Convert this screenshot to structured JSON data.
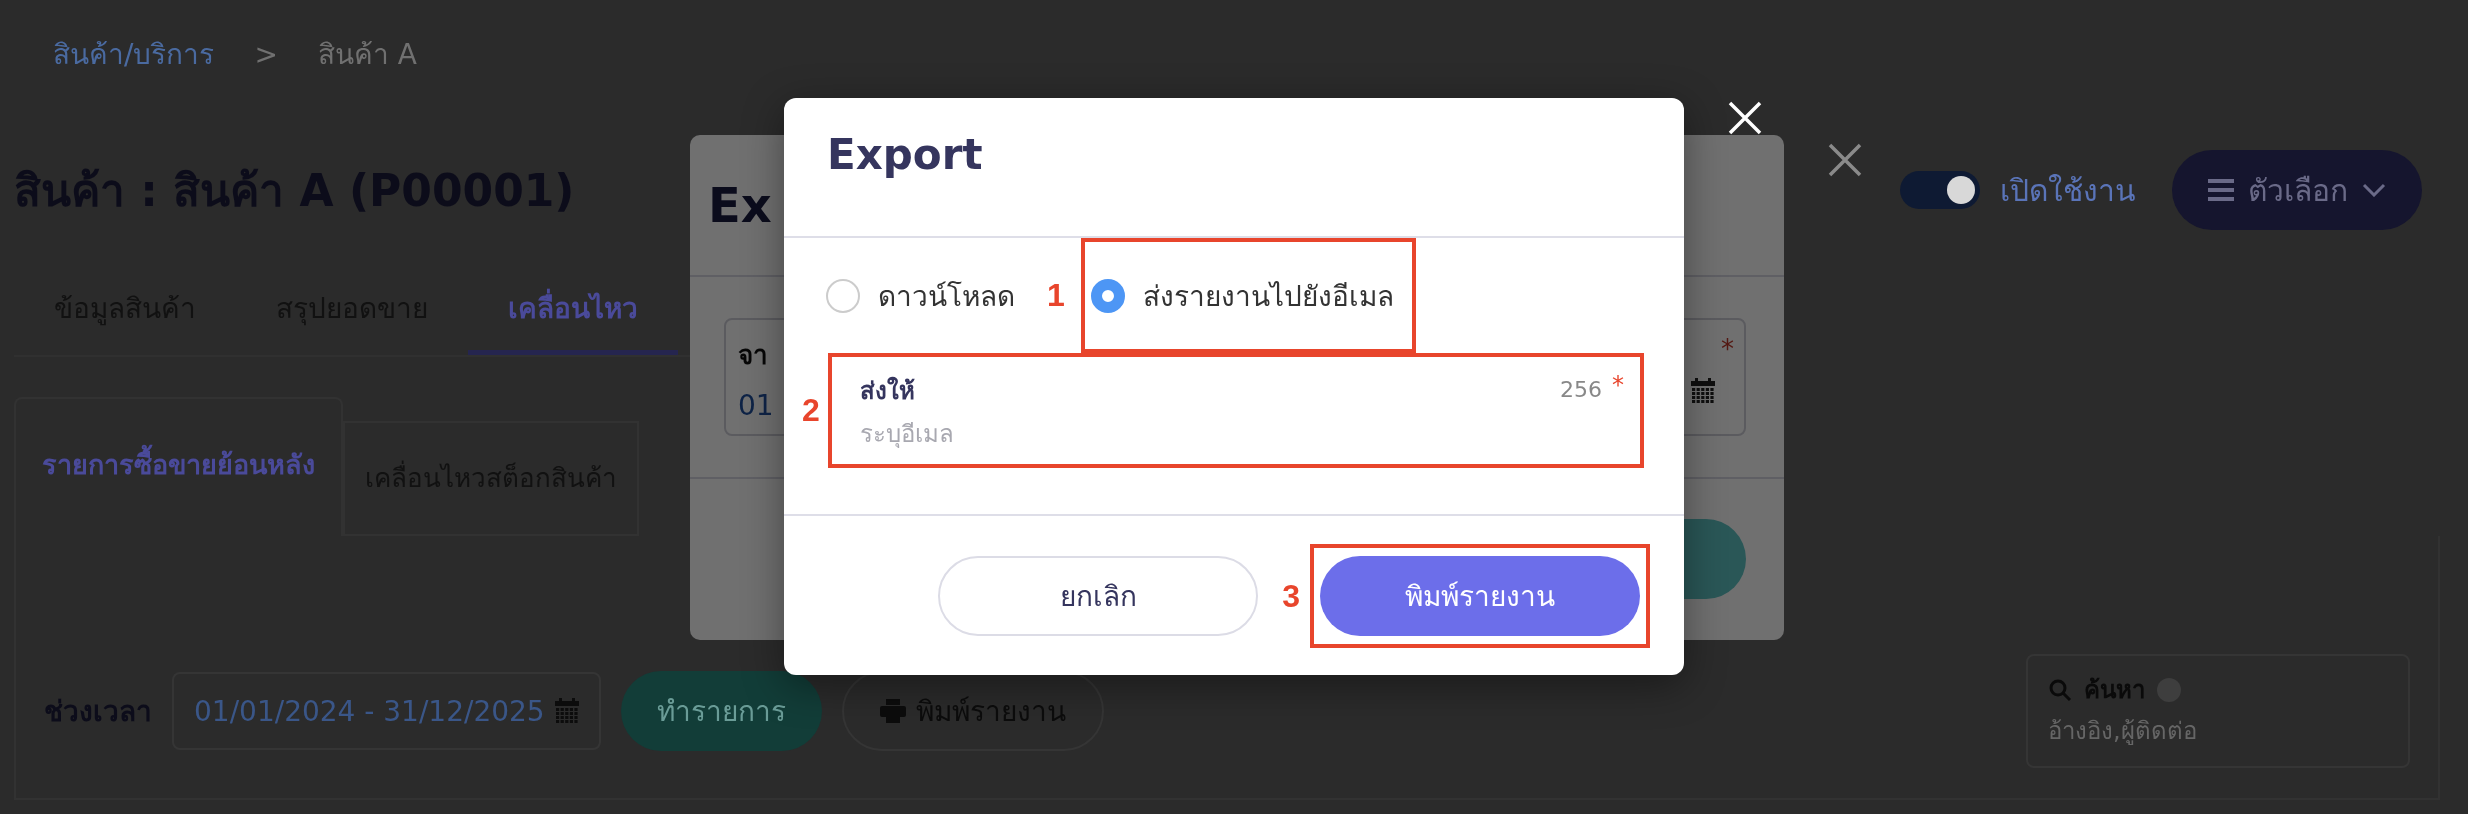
{
  "breadcrumb": [
    {
      "label": "สินค้า/บริการ",
      "kind": "link"
    },
    {
      "label": ">",
      "kind": "separator"
    },
    {
      "label": "สินค้า A",
      "kind": "current"
    }
  ],
  "page_title": "สินค้า : สินค้า A (P00001)",
  "status_toggle": {
    "label": "เปิดใช้งาน",
    "on": true
  },
  "options_button": {
    "label": "ตัวเลือก"
  },
  "tabs": [
    {
      "label": "ข้อมูลสินค้า",
      "selected": false
    },
    {
      "label": "สรุปยอดขาย",
      "selected": false
    },
    {
      "label": "เคลื่อนไหว",
      "selected": true
    }
  ],
  "sub_tabs": [
    {
      "label": "รายการซื้อขายย้อนหลัง",
      "selected": true
    },
    {
      "label": "เคลื่อนไหวสต็อกสินค้า",
      "selected": false
    }
  ],
  "filter": {
    "label": "ช่วงเวลา",
    "date_range": "01/01/2024 - 31/12/2025",
    "buttons": [
      {
        "label": "ทำรายการ",
        "kind": "primary"
      },
      {
        "label": "พิมพ์รายงาน",
        "kind": "outline"
      }
    ]
  },
  "search": {
    "label": "ค้นหา",
    "placeholder": "อ้างอิง,ผู้ติดต่อ"
  },
  "background_dialog": {
    "title": "Ex",
    "field_label": "จา",
    "field_value": "01",
    "required_mark": "*"
  },
  "dialog": {
    "title": "Export",
    "options": [
      {
        "label": "ดาวน์โหลด",
        "selected": false
      },
      {
        "label": "ส่งรายงานไปยังอีเมล",
        "selected": true
      }
    ],
    "field": {
      "label": "ส่งให้",
      "counter": "256",
      "required_mark": "*",
      "placeholder": "ระบุอีเมล"
    },
    "buttons": [
      {
        "label": "ยกเลิก",
        "kind": "secondary"
      },
      {
        "label": "พิมพ์รายงาน",
        "kind": "primary"
      }
    ]
  },
  "annotations": [
    "1",
    "2",
    "3"
  ]
}
